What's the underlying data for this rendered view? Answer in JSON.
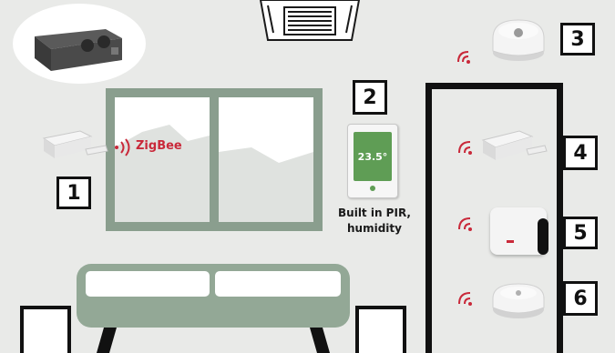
{
  "labels": {
    "zigbee": "ZigBee",
    "pir_line1": "Built in PIR,",
    "pir_line2": "humidity",
    "thermostat_temp": "23.5°",
    "numbers": [
      "1",
      "2",
      "3",
      "4",
      "5",
      "6"
    ]
  },
  "colors": {
    "background": "#e9eae8",
    "window_frame": "#8a9e8e",
    "sofa": "#93a896",
    "signal_red": "#c9293a",
    "thermostat_screen": "#5f9d55"
  },
  "icons": [
    "ventilation-unit-icon",
    "ceiling-vent-icon",
    "door-window-sensor-icon",
    "thermostat-icon",
    "ceiling-sensor-icon",
    "hub-icon",
    "round-sensor-icon",
    "signal-wave-icon"
  ]
}
